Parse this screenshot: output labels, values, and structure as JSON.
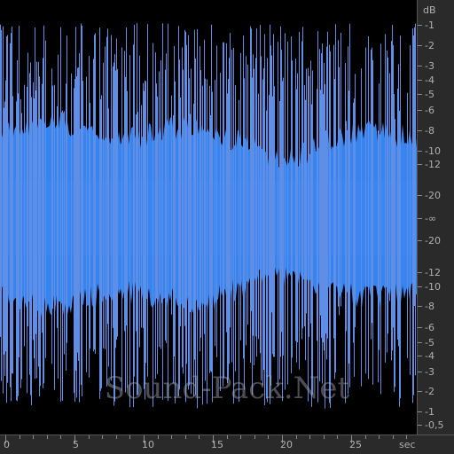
{
  "colors": {
    "background": "#000000",
    "waveform_body": "#3584f0",
    "waveform_peaks": "#5f8ee6",
    "ruler_background": "#2a2a2a",
    "ruler_text": "#b0b0b0"
  },
  "db_ruler": {
    "unit_label": "dB",
    "ticks": [
      {
        "label": "-1",
        "level": 1,
        "side": "top"
      },
      {
        "label": "-2",
        "level": 2,
        "side": "top"
      },
      {
        "label": "-3",
        "level": 3,
        "side": "top"
      },
      {
        "label": "-4",
        "level": 4,
        "side": "top"
      },
      {
        "label": "-5",
        "level": 5,
        "side": "top"
      },
      {
        "label": "-6",
        "level": 6,
        "side": "top"
      },
      {
        "label": "-8",
        "level": 8,
        "side": "top"
      },
      {
        "label": "-10",
        "level": 10,
        "side": "top"
      },
      {
        "label": "-12",
        "level": 12,
        "side": "top"
      },
      {
        "label": "-20",
        "level": 20,
        "side": "top"
      },
      {
        "label": "-∞",
        "level": 999,
        "side": "center"
      },
      {
        "label": "-20",
        "level": 20,
        "side": "bottom"
      },
      {
        "label": "-12",
        "level": 12,
        "side": "bottom"
      },
      {
        "label": "-10",
        "level": 10,
        "side": "bottom"
      },
      {
        "label": "-8",
        "level": 8,
        "side": "bottom"
      },
      {
        "label": "-6",
        "level": 6,
        "side": "bottom"
      },
      {
        "label": "-5",
        "level": 5,
        "side": "bottom"
      },
      {
        "label": "-4",
        "level": 4,
        "side": "bottom"
      },
      {
        "label": "-3",
        "level": 3,
        "side": "bottom"
      },
      {
        "label": "-2",
        "level": 2,
        "side": "bottom"
      },
      {
        "label": "-1",
        "level": 1,
        "side": "bottom"
      },
      {
        "label": "-0,5",
        "level": 0.5,
        "side": "bottom"
      }
    ]
  },
  "time_ruler": {
    "unit_label": "sec",
    "ticks": [
      {
        "label": "0",
        "seconds": 0
      },
      {
        "label": "5",
        "seconds": 5
      },
      {
        "label": "10",
        "seconds": 10
      },
      {
        "label": "15",
        "seconds": 15
      },
      {
        "label": "20",
        "seconds": 20
      },
      {
        "label": "25",
        "seconds": 25
      }
    ]
  },
  "watermark": "Sound-Pack.Net"
}
